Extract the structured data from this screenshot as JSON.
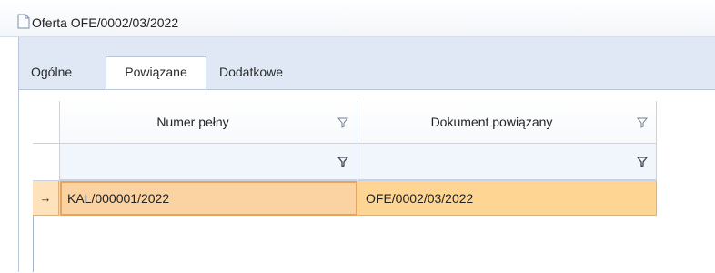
{
  "window": {
    "title": "Oferta OFE/0002/03/2022",
    "icon": "document-icon"
  },
  "tabs": [
    {
      "label": "Ogólne",
      "active": false
    },
    {
      "label": "Powiązane",
      "active": true
    },
    {
      "label": "Dodatkowe",
      "active": false
    }
  ],
  "grid": {
    "columns": [
      {
        "label": "Numer pełny"
      },
      {
        "label": "Dokument powiązany"
      }
    ],
    "rows": [
      {
        "indicator": "→",
        "cells": [
          "KAL/000001/2022",
          "OFE/0002/03/2022"
        ],
        "selected": true
      }
    ],
    "filter_icon": "filter-icon"
  },
  "colors": {
    "tab_background": "#dfe8f4",
    "selected_row": "#fdd59e",
    "focus_border": "#e8a45d"
  }
}
